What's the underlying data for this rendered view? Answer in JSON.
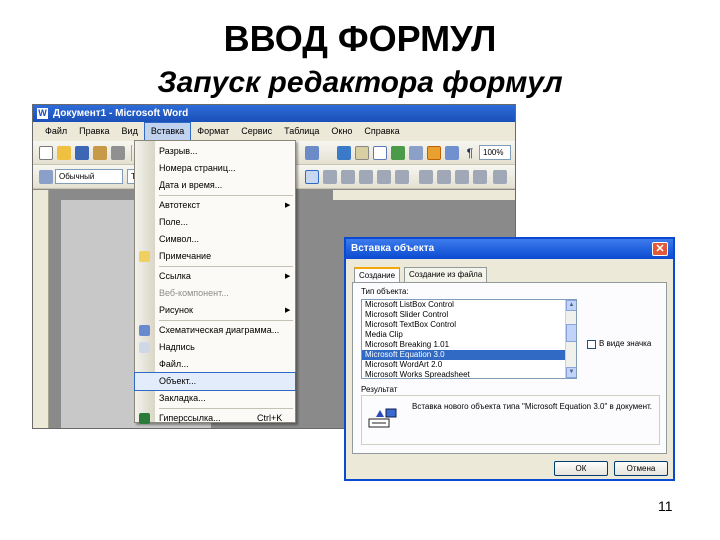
{
  "slide": {
    "title": "ВВОД ФОРМУЛ",
    "subtitle": "Запуск редактора формул",
    "page_number": "11"
  },
  "word": {
    "window_title": "Документ1 - Microsoft Word",
    "app_icon": "W",
    "menu": [
      "Файл",
      "Правка",
      "Вид",
      "Вставка",
      "Формат",
      "Сервис",
      "Таблица",
      "Окно",
      "Справка"
    ],
    "style_combo": "Обычный",
    "font_combo": "T",
    "zoom": "100%"
  },
  "insert_menu": {
    "items": [
      {
        "label": "Разрыв...",
        "accel": "",
        "arrow": false,
        "disabled": false,
        "icon": "none"
      },
      {
        "label": "Номера страниц...",
        "accel": "",
        "arrow": false,
        "disabled": false,
        "icon": "none"
      },
      {
        "label": "Дата и время...",
        "accel": "",
        "arrow": false,
        "disabled": false,
        "icon": "none"
      },
      {
        "label": "Автотекст",
        "accel": "",
        "arrow": true,
        "disabled": false,
        "icon": "none"
      },
      {
        "label": "Поле...",
        "accel": "",
        "arrow": false,
        "disabled": false,
        "icon": "none"
      },
      {
        "label": "Символ...",
        "accel": "",
        "arrow": false,
        "disabled": false,
        "icon": "none"
      },
      {
        "label": "Примечание",
        "accel": "",
        "arrow": false,
        "disabled": false,
        "icon": "comment-icon"
      },
      {
        "label": "Ссылка",
        "accel": "",
        "arrow": true,
        "disabled": false,
        "icon": "none"
      },
      {
        "label": "Веб-компонент...",
        "accel": "",
        "arrow": false,
        "disabled": true,
        "icon": "none"
      },
      {
        "label": "Рисунок",
        "accel": "",
        "arrow": true,
        "disabled": false,
        "icon": "none"
      },
      {
        "label": "Схематическая диаграмма...",
        "accel": "",
        "arrow": false,
        "disabled": false,
        "icon": "diagram-icon"
      },
      {
        "label": "Надпись",
        "accel": "",
        "arrow": false,
        "disabled": false,
        "icon": "textbox-icon"
      },
      {
        "label": "Файл...",
        "accel": "",
        "arrow": false,
        "disabled": false,
        "icon": "none"
      },
      {
        "label": "Объект...",
        "accel": "",
        "arrow": false,
        "disabled": false,
        "icon": "none"
      },
      {
        "label": "Закладка...",
        "accel": "",
        "arrow": false,
        "disabled": false,
        "icon": "none"
      },
      {
        "label": "Гиперссылка...",
        "accel": "Ctrl+K",
        "arrow": false,
        "disabled": false,
        "icon": "hyperlink-icon"
      }
    ]
  },
  "dialog": {
    "title": "Вставка объекта",
    "close_glyph": "✕",
    "tabs": [
      "Создание",
      "Создание из файла"
    ],
    "object_type_label": "Тип объекта:",
    "object_types": [
      "Microsoft ListBox Control",
      "Microsoft Slider Control",
      "Microsoft TextBox Control",
      "Media Clip",
      "Microsoft Breaking 1.01",
      "Microsoft Equation 3.0",
      "Microsoft WordArt 2.0",
      "Microsoft Works Spreadsheet"
    ],
    "selected_index": 5,
    "as_icon_label": "В виде значка",
    "result_label": "Результат",
    "result_text": "Вставка нового объекта типа \"Microsoft Equation 3.0\" в документ.",
    "ok_label": "ОК",
    "cancel_label": "Отмена"
  },
  "colors": {
    "titlebar_blue": "#0a4ad0",
    "selection_blue": "#316ac5",
    "menu_bg": "#ece9d8"
  }
}
